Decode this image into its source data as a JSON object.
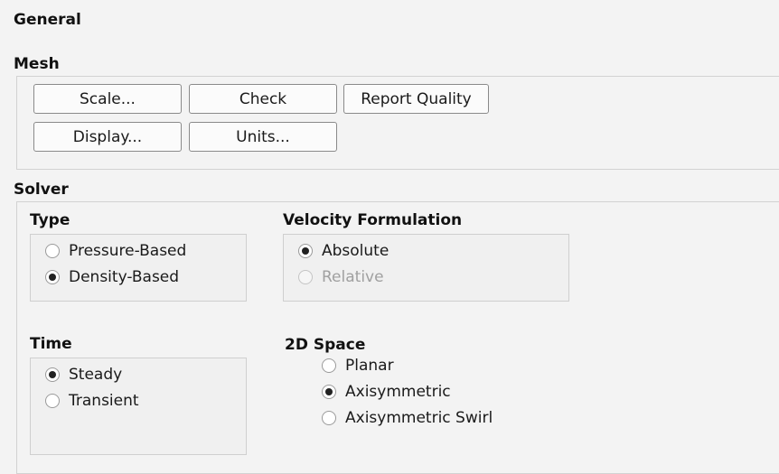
{
  "general_title": "General",
  "mesh": {
    "title": "Mesh",
    "buttons": {
      "scale": "Scale...",
      "check": "Check",
      "report_quality": "Report Quality",
      "display": "Display...",
      "units": "Units..."
    }
  },
  "solver": {
    "title": "Solver",
    "type": {
      "title": "Type",
      "options": [
        "Pressure-Based",
        "Density-Based"
      ],
      "selected": "Density-Based"
    },
    "velocity_formulation": {
      "title": "Velocity Formulation",
      "options": [
        "Absolute",
        "Relative"
      ],
      "selected": "Absolute",
      "disabled": [
        "Relative"
      ]
    },
    "time": {
      "title": "Time",
      "options": [
        "Steady",
        "Transient"
      ],
      "selected": "Steady"
    },
    "space_2d": {
      "title": "2D Space",
      "options": [
        "Planar",
        "Axisymmetric",
        "Axisymmetric Swirl"
      ],
      "selected": "Axisymmetric"
    }
  }
}
